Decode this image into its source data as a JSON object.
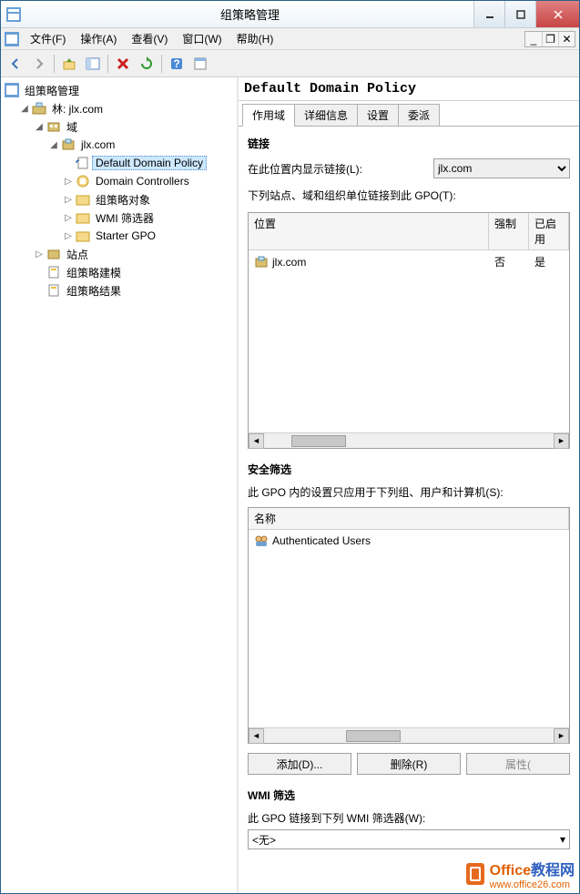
{
  "window": {
    "title": "组策略管理"
  },
  "menu": {
    "file": "文件(F)",
    "action": "操作(A)",
    "view": "查看(V)",
    "window": "窗口(W)",
    "help": "帮助(H)"
  },
  "tree": {
    "root": "组策略管理",
    "forest": "林: jlx.com",
    "domains": "域",
    "domain": "jlx.com",
    "ddp": "Default Domain Policy",
    "dc": "Domain Controllers",
    "gpo": "组策略对象",
    "wmi": "WMI 筛选器",
    "starter": "Starter GPO",
    "sites": "站点",
    "model": "组策略建模",
    "result": "组策略结果"
  },
  "content": {
    "policy_title": "Default Domain Policy",
    "tabs": {
      "scope": "作用域",
      "details": "详细信息",
      "settings": "设置",
      "deleg": "委派"
    },
    "links_hdr": "链接",
    "show_links_label": "在此位置内显示链接(L):",
    "location_sel": "jlx.com",
    "linked_label": "下列站点、域和组织单位链接到此 GPO(T):",
    "cols": {
      "loc": "位置",
      "force": "强制",
      "enable": "已启用"
    },
    "link_rows": [
      {
        "loc": "jlx.com",
        "force": "否",
        "enable": "是"
      }
    ],
    "sec_hdr": "安全筛选",
    "sec_label": "此 GPO 内的设置只应用于下列组、用户和计算机(S):",
    "name_col": "名称",
    "sec_rows": [
      "Authenticated Users"
    ],
    "btn_add": "添加(D)...",
    "btn_del": "删除(R)",
    "btn_prop": "属性(",
    "wmi_hdr": "WMI 筛选",
    "wmi_label": "此 GPO 链接到下列 WMI 筛选器(W):",
    "wmi_sel": "<无>"
  },
  "watermark": {
    "t1": "Office",
    "t2": "教程网",
    "url": "www.office26.com"
  }
}
